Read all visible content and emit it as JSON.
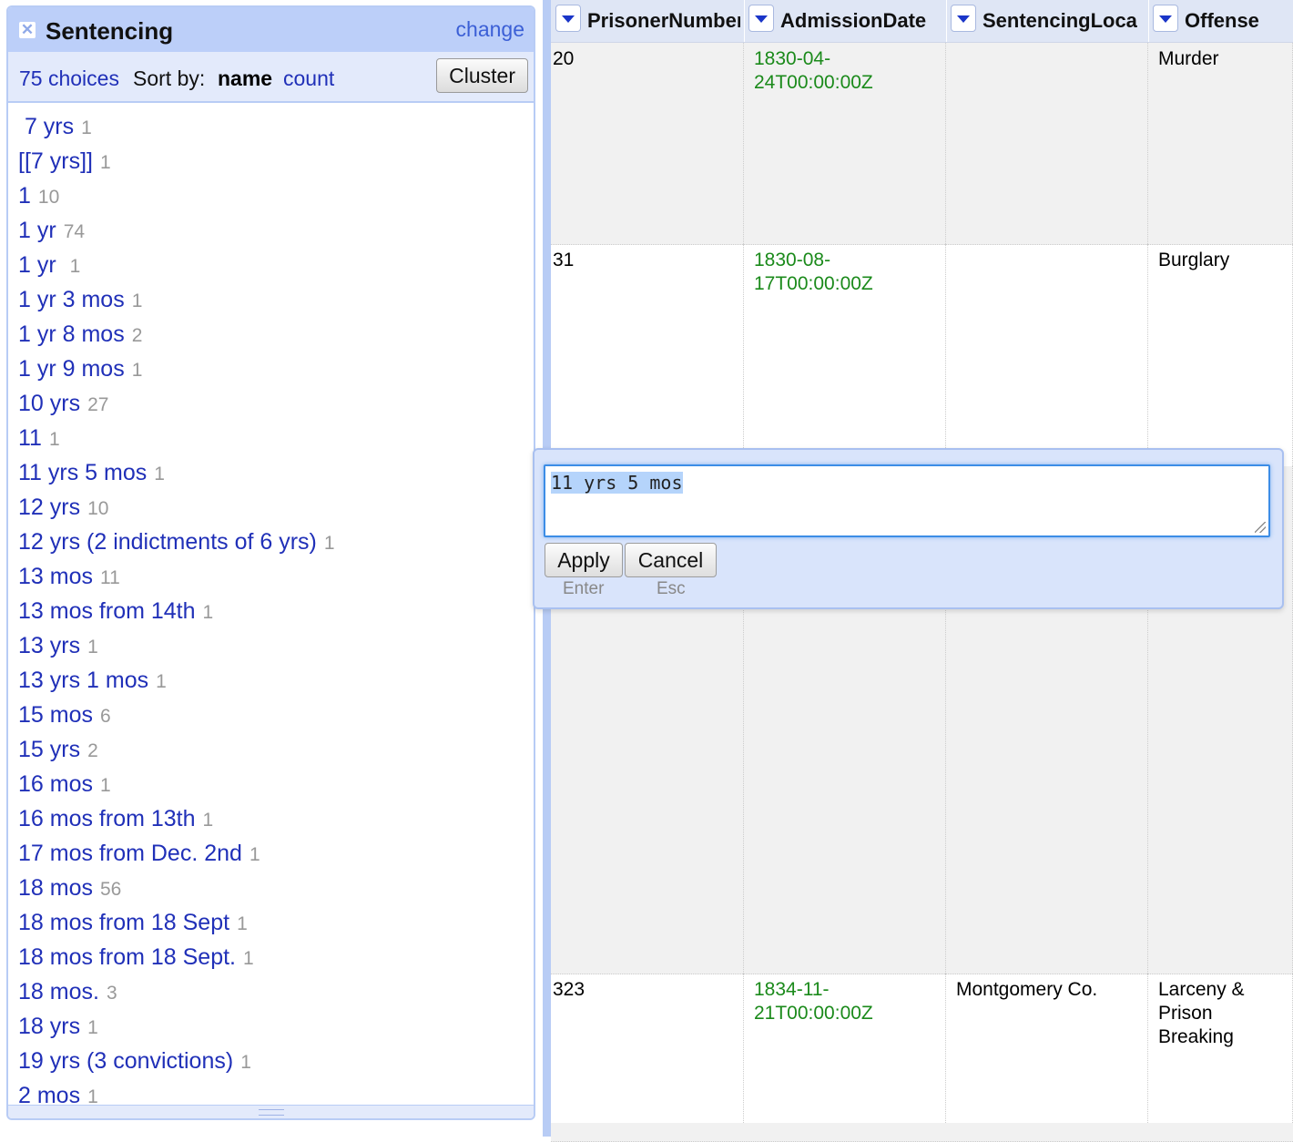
{
  "facet": {
    "title": "Sentencing",
    "change_label": "change",
    "close_glyph": "✕",
    "choices_label": "75 choices",
    "sort_by_label": "Sort by:",
    "sort_name": "name",
    "sort_count": "count",
    "cluster_label": "Cluster",
    "choices": [
      {
        "label": " 7 yrs",
        "count": "1"
      },
      {
        "label": "[[7 yrs]]",
        "count": "1"
      },
      {
        "label": "1",
        "count": "10"
      },
      {
        "label": "1 yr",
        "count": "74"
      },
      {
        "label": "1 yr ",
        "count": "1"
      },
      {
        "label": "1 yr 3 mos",
        "count": "1"
      },
      {
        "label": "1 yr 8 mos",
        "count": "2"
      },
      {
        "label": "1 yr 9 mos",
        "count": "1"
      },
      {
        "label": "10 yrs",
        "count": "27"
      },
      {
        "label": "11",
        "count": "1"
      },
      {
        "label": "11 yrs 5 mos",
        "count": "1"
      },
      {
        "label": "12 yrs",
        "count": "10"
      },
      {
        "label": "12 yrs (2 indictments of 6 yrs)",
        "count": "1"
      },
      {
        "label": "13 mos",
        "count": "11"
      },
      {
        "label": "13 mos from 14th",
        "count": "1"
      },
      {
        "label": "13 yrs",
        "count": "1"
      },
      {
        "label": "13 yrs 1 mos",
        "count": "1"
      },
      {
        "label": "15 mos",
        "count": "6"
      },
      {
        "label": "15 yrs",
        "count": "2"
      },
      {
        "label": "16 mos",
        "count": "1"
      },
      {
        "label": "16 mos from 13th",
        "count": "1"
      },
      {
        "label": "17 mos from Dec. 2nd",
        "count": "1"
      },
      {
        "label": "18 mos",
        "count": "56"
      },
      {
        "label": "18 mos from 18 Sept",
        "count": "1"
      },
      {
        "label": "18 mos from 18 Sept.",
        "count": "1"
      },
      {
        "label": "18 mos.",
        "count": "3"
      },
      {
        "label": "18 yrs",
        "count": "1"
      },
      {
        "label": "19 yrs (3 convictions)",
        "count": "1"
      },
      {
        "label": "2 mos",
        "count": "1"
      }
    ]
  },
  "grid": {
    "columns": [
      "PrisonerNumber",
      "AdmissionDate",
      "SentencingLoca",
      "Offense"
    ],
    "rows": [
      {
        "PrisonerNumber": "20",
        "AdmissionDate": "1830-04-\n24T00:00:00Z",
        "SentencingLoca": "",
        "Offense": "Murder"
      },
      {
        "PrisonerNumber": "31",
        "AdmissionDate": "1830-08-\n17T00:00:00Z",
        "SentencingLoca": "",
        "Offense": "Burglary"
      },
      {
        "PrisonerNumber": "",
        "AdmissionDate": "",
        "SentencingLoca": "",
        "Offense": ""
      },
      {
        "PrisonerNumber": "323",
        "AdmissionDate": "1834-11-\n21T00:00:00Z",
        "SentencingLoca": "Montgomery Co.",
        "Offense": "Larceny &\nPrison\nBreaking"
      }
    ]
  },
  "editor": {
    "value": "11 yrs 5 mos",
    "apply_label": "Apply",
    "apply_hint": "Enter",
    "cancel_label": "Cancel",
    "cancel_hint": "Esc"
  }
}
